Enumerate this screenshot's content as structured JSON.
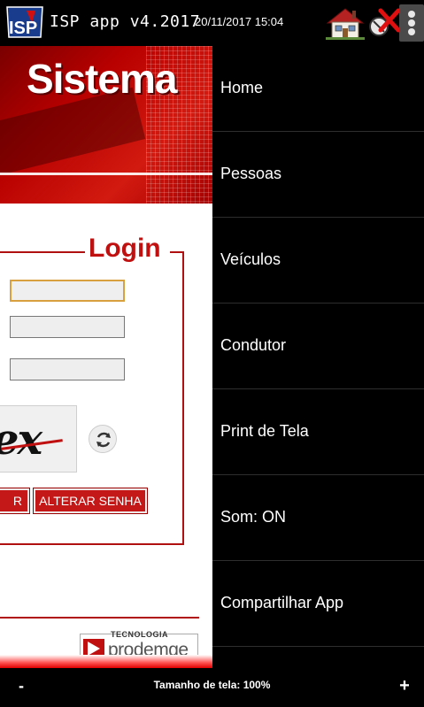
{
  "app": {
    "logo_text": "ISP",
    "title": "ISP app v4.2017",
    "datetime": "20/11/2017 15:04",
    "icons": {
      "home": "home-icon",
      "exit": "close-icon",
      "menu": "overflow-menu-icon",
      "refresh": "refresh-icon"
    }
  },
  "web": {
    "banner_title": "Sistema",
    "login_title": "Login",
    "fields": [
      {
        "name": "username",
        "value": "",
        "placeholder": ""
      },
      {
        "name": "password",
        "value": "",
        "placeholder": ""
      },
      {
        "name": "captcha",
        "value": "",
        "placeholder": ""
      }
    ],
    "captcha_text": "ex",
    "enter_button": "R",
    "change_password_button": "ALTERAR SENHA",
    "tech_label": "TECNOLOGIA",
    "tech_brand": "prodemge"
  },
  "menu": {
    "items": [
      {
        "label": "Home"
      },
      {
        "label": "Pessoas"
      },
      {
        "label": "Veículos"
      },
      {
        "label": "Condutor"
      },
      {
        "label": "Print de Tela"
      },
      {
        "label": "Som: ON"
      },
      {
        "label": "Compartilhar App"
      }
    ]
  },
  "zoom": {
    "minus": "-",
    "label": "Tamanho de tela: 100%",
    "plus": "+",
    "level_percent": 100
  },
  "colors": {
    "brand_red": "#c01010",
    "menu_bg": "#000000",
    "menu_text": "#ffffff",
    "field_focus": "#d9a040"
  }
}
